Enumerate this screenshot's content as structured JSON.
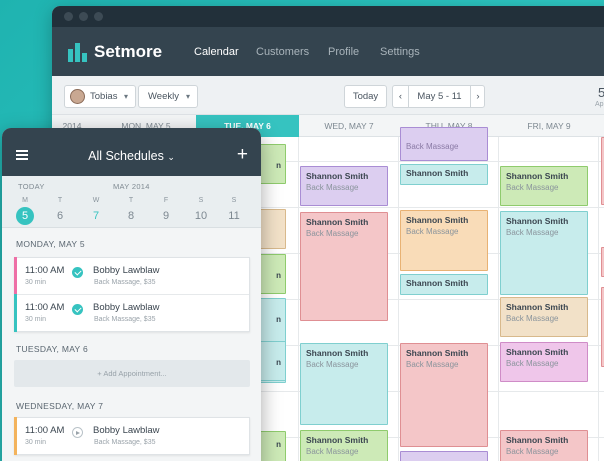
{
  "brand": {
    "name": "Setmore"
  },
  "nav": {
    "items": [
      "Calendar",
      "Customers",
      "Profile",
      "Settings"
    ],
    "active": "Calendar"
  },
  "toolbar": {
    "staff": "Tobias",
    "view": "Weekly",
    "today": "Today",
    "range": "May 5 - 11",
    "right_num": "5",
    "right_sub": "Ap"
  },
  "days": {
    "year_label": "2014",
    "headers": [
      "MON, MAY 5",
      "TUE, MAY 6",
      "WED, MAY 7",
      "THU, MAY 8",
      "FRI, MAY 9"
    ]
  },
  "appointments": {
    "name": "Shannon Smith",
    "service": "Back Massage",
    "partial": "n"
  },
  "mobile": {
    "title": "All Schedules",
    "today_label": "TODAY",
    "month_label": "MAY 2014",
    "week_days": [
      "M",
      "T",
      "W",
      "T",
      "F",
      "S",
      "S"
    ],
    "week_nums": [
      "5",
      "6",
      "7",
      "8",
      "9",
      "10",
      "11"
    ],
    "sections": {
      "monday": "MONDAY, MAY 5",
      "tuesday": "TUESDAY, MAY 6",
      "wednesday": "WEDNESDAY, MAY 7"
    },
    "appts": [
      {
        "time": "11:00 AM",
        "dur": "30 min",
        "name": "Bobby Lawblaw",
        "service": "Back Massage, $35"
      },
      {
        "time": "11:00 AM",
        "dur": "30 min",
        "name": "Bobby Lawblaw",
        "service": "Back Massage, $35"
      },
      {
        "time": "11:00 AM",
        "dur": "30 min",
        "name": "Bobby Lawblaw",
        "service": "Back Massage, $35"
      }
    ],
    "add_label": "+ Add Appointment..."
  },
  "colors": {
    "accent": "#36c3c0",
    "navbar": "#34444f",
    "background": "#1fb3b0",
    "bar_pink": "#ee6fa6",
    "bar_teal": "#36c3c0",
    "bar_orange": "#f3b35c"
  }
}
